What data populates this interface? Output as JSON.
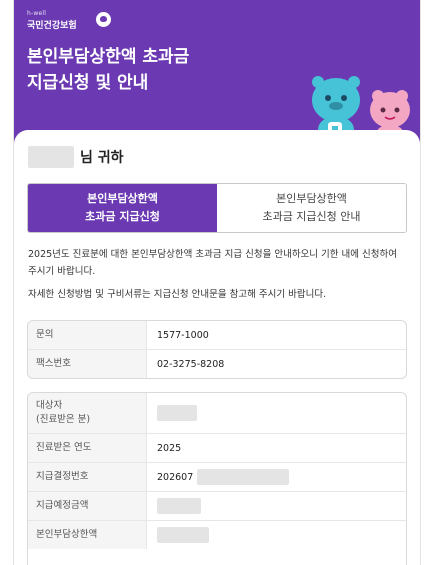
{
  "logo": {
    "sub": "h-well",
    "main": "국민건강보험"
  },
  "header": {
    "title_line1": "본인부담상한액 초과금",
    "title_line2": "지급신청 및 안내"
  },
  "greeting": {
    "suffix": "님 귀하"
  },
  "tabs": [
    {
      "line1": "본인부담상한액",
      "line2": "초과금 지급신청",
      "active": true
    },
    {
      "line1": "본인부담상한액",
      "line2": "초과금 지급신청 안내",
      "active": false
    }
  ],
  "intro": {
    "p1": "2025년도 진료분에 대한 본인부담상한액 초과금 지급 신청을 안내하오니 기한 내에 신청하여 주시기 바랍니다.",
    "p2": "자세한 신청방법 및 구비서류는 지급신청 안내문을 참고해 주시기 바랍니다."
  },
  "contact": {
    "rows": [
      {
        "label": "문의",
        "value": "1577-1000"
      },
      {
        "label": "팩스번호",
        "value": "02-3275-8208"
      }
    ]
  },
  "details": {
    "target_label_1": "대상자",
    "target_label_2": "(진료받은 분)",
    "year_label": "진료받은 연도",
    "year_value": "2025",
    "decision_label": "지급결정번호",
    "decision_value": "202607",
    "expected_label": "지급예정금액",
    "cap_label": "본인부담상한액"
  },
  "colors": {
    "brand": "#6b3ab2",
    "redaction": "#e4e4e4"
  },
  "icons": {
    "logo": "heart-logo-icon",
    "mascot_blue": "blue-mascot-icon",
    "mascot_pink": "pink-mascot-icon"
  }
}
